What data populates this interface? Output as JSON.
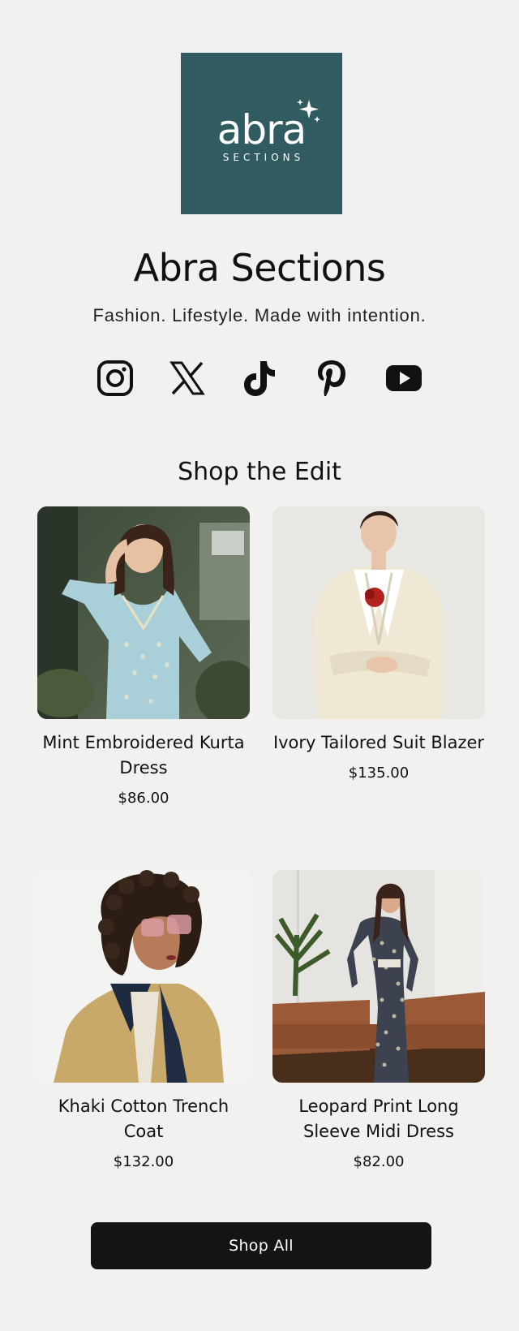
{
  "brand": {
    "logo_word": "abra",
    "logo_sub": "SECTIONS",
    "logo_color": "#2f5b61",
    "title": "Abra Sections",
    "tagline": "Fashion. Lifestyle. Made with intention."
  },
  "social": [
    {
      "icon": "instagram-icon"
    },
    {
      "icon": "x-icon"
    },
    {
      "icon": "tiktok-icon"
    },
    {
      "icon": "pinterest-icon"
    },
    {
      "icon": "youtube-icon"
    }
  ],
  "section": {
    "title": "Shop the Edit"
  },
  "products": [
    {
      "name": "Mint Embroidered Kurta Dress",
      "price": "$86.00"
    },
    {
      "name": "Ivory Tailored Suit Blazer",
      "price": "$135.00"
    },
    {
      "name": "Khaki Cotton Trench Coat",
      "price": "$132.00"
    },
    {
      "name": "Leopard Print Long Sleeve Midi Dress",
      "price": "$82.00"
    }
  ],
  "cta": {
    "label": "Shop All"
  }
}
